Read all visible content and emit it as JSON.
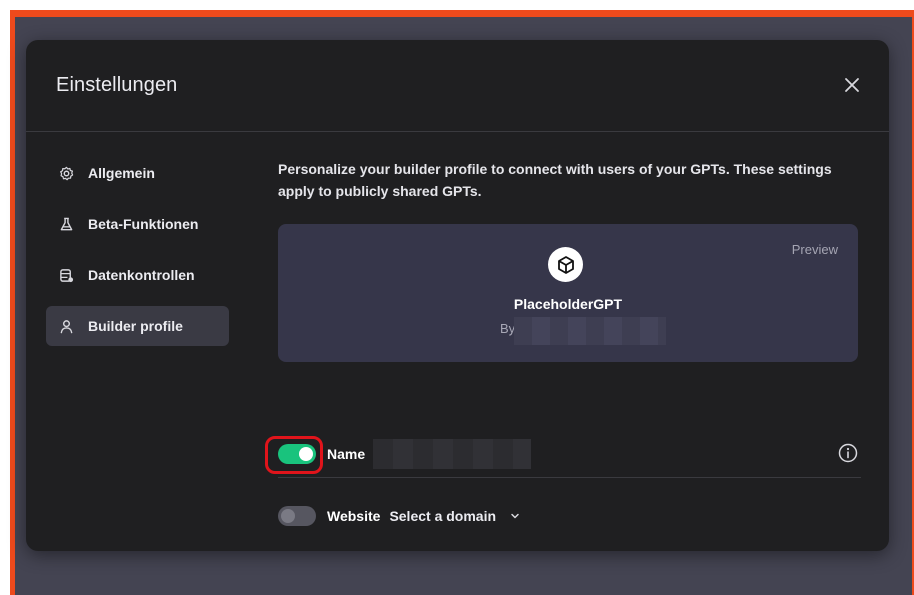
{
  "modal": {
    "title": "Einstellungen"
  },
  "sidebar": {
    "items": [
      {
        "label": "Allgemein",
        "icon": "gear-icon"
      },
      {
        "label": "Beta-Funktionen",
        "icon": "flask-icon"
      },
      {
        "label": "Datenkontrollen",
        "icon": "database-icon"
      },
      {
        "label": "Builder profile",
        "icon": "user-icon",
        "active": true
      }
    ]
  },
  "content": {
    "description": "Personalize your builder profile to connect with users of your GPTs. These settings apply to publicly shared GPTs.",
    "preview": {
      "label": "Preview",
      "gpt_name": "PlaceholderGPT",
      "by_prefix": "By",
      "avatar_icon": "cube-icon"
    },
    "name_row": {
      "label": "Name",
      "toggle_on": true,
      "info_icon": "info-icon"
    },
    "website_row": {
      "label": "Website",
      "select_value": "Select a domain",
      "toggle_on": false
    }
  },
  "colors": {
    "frame": "#ee4a1c",
    "toggle_on": "#19c37d",
    "highlight": "#e0141b"
  }
}
